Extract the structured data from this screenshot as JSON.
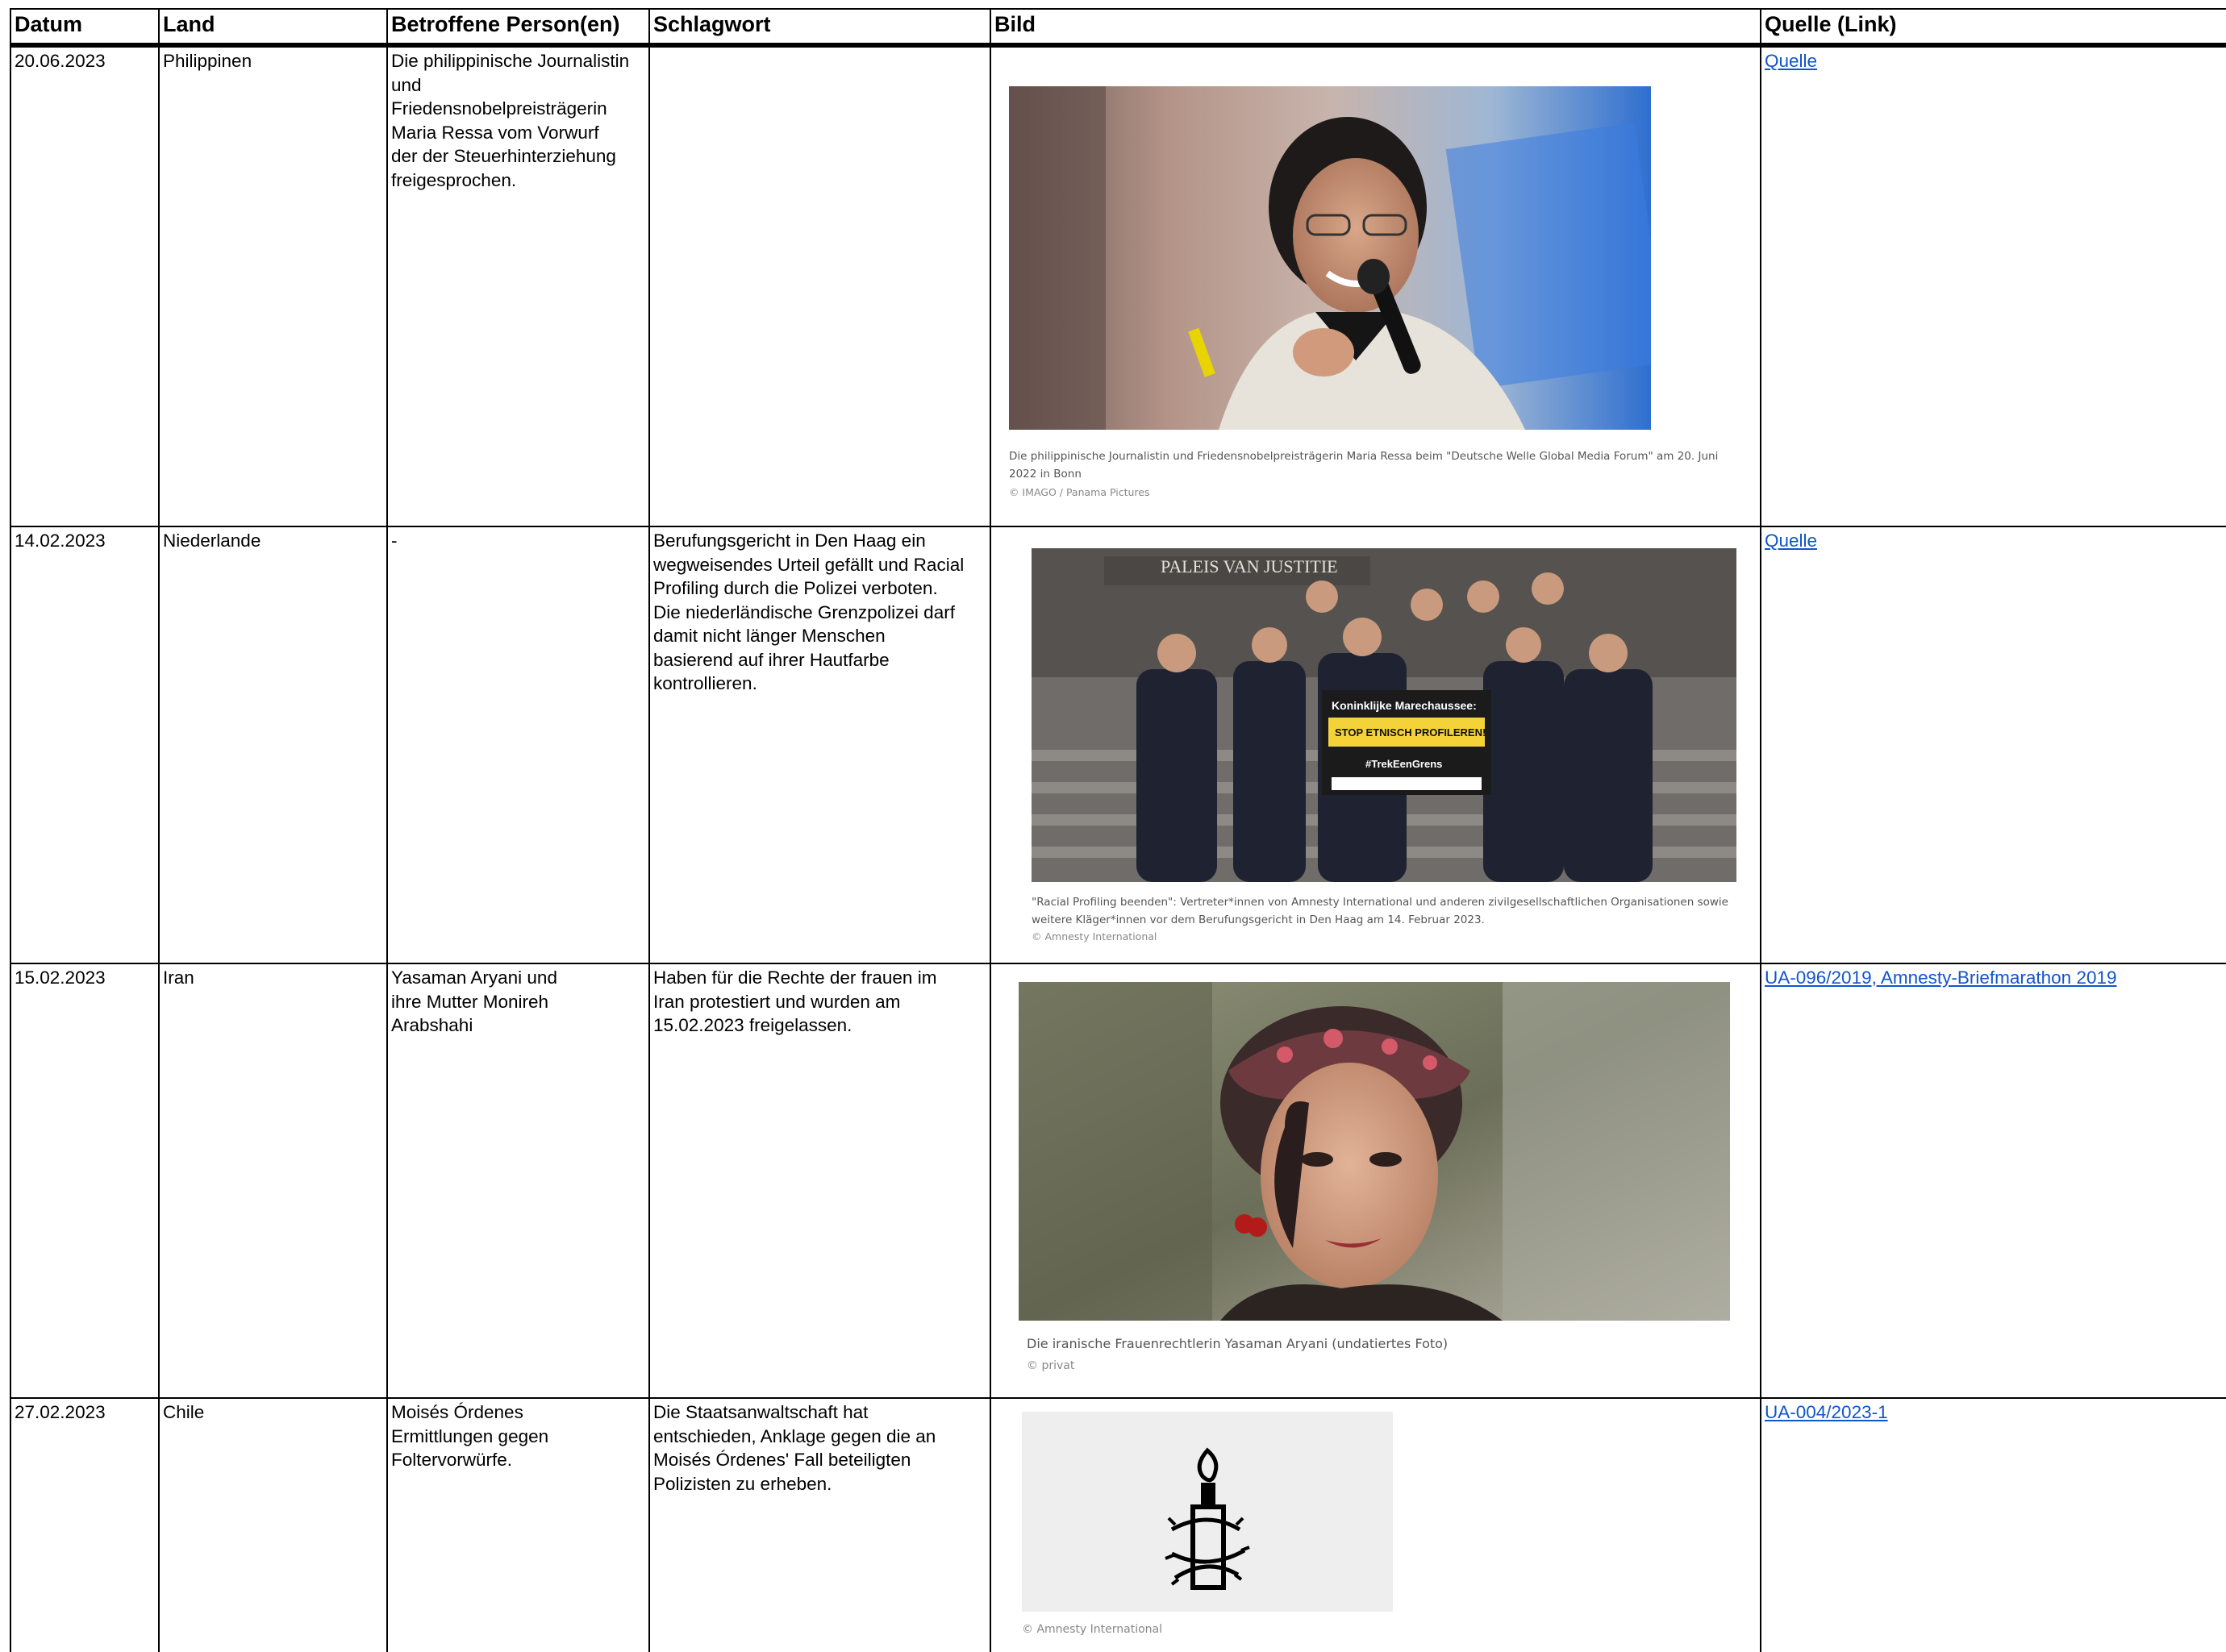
{
  "columns": {
    "datum": "Datum",
    "land": "Land",
    "personen": "Betroffene Person(en)",
    "schlagwort": "Schlagwort",
    "bild": "Bild",
    "quelle": "Quelle (Link)"
  },
  "rows": [
    {
      "datum": "20.06.2023",
      "land": "Philippinen",
      "personen": "Die philippinische Journalistin\nund\nFriedensnobelpreisträgerin\nMaria Ressa vom Vorwurf\nder der Steuerhinterziehung\nfreigesprochen.",
      "schlagwort": "",
      "caption": "Die philippinische Journalistin und Friedensnobelpreisträgerin Maria Ressa beim \"Deutsche Welle Global Media Forum\" am 20. Juni\n2022 in Bonn",
      "credit": "© IMAGO / Panama Pictures",
      "quelle": "Quelle"
    },
    {
      "datum": "14.02.2023",
      "land": "Niederlande",
      "personen": "-",
      "schlagwort": "Berufungsgericht in Den Haag ein\n wegweisendes Urteil gefällt und Racial\nProfiling durch die Polizei verboten.\nDie niederländische Grenzpolizei darf\ndamit nicht länger Menschen\nbasierend auf ihrer Hautfarbe\nkontrollieren.",
      "building_sign": "PALEIS VAN JUSTITIE",
      "banner_line1": "Koninklijke Marechaussee:",
      "banner_line2": "STOP ETNISCH PROFILEREN!",
      "banner_line3": "#TrekEenGrens",
      "caption": "\"Racial Profiling beenden\": Vertreter*innen von Amnesty International und anderen zivilgesellschaftlichen Organisationen sowie\nweitere Kläger*innen vor dem Berufungsgericht in Den Haag am 14. Februar 2023.",
      "credit": "© Amnesty International",
      "quelle": "Quelle"
    },
    {
      "datum": "15.02.2023",
      "land": "Iran",
      "personen": "Yasaman Aryani und\nihre Mutter Monireh\nArabshahi",
      "schlagwort": "Haben für die Rechte der frauen im\nIran protestiert und wurden am\n15.02.2023 freigelassen.",
      "caption": "Die iranische Frauenrechtlerin Yasaman Aryani (undatiertes Foto)",
      "credit": "© privat",
      "quelle": "UA-096/2019, Amnesty-Briefmarathon 2019"
    },
    {
      "datum": "27.02.2023",
      "land": "Chile",
      "personen": "Moisés Órdenes\nErmittlungen gegen\nFoltervorwürfe.",
      "schlagwort": "Die Staatsanwaltschaft hat\nentschieden, Anklage gegen die an\nMoisés Órdenes' Fall beteiligten\nPolizisten zu erheben.",
      "caption": "",
      "credit": "© Amnesty International",
      "quelle": "UA-004/2023-1"
    }
  ],
  "colors": {
    "link": "#1155cc",
    "grid": "#000000",
    "caption": "#555555"
  },
  "icons": {
    "amnesty_logo": "candle-barbed-wire-icon"
  }
}
